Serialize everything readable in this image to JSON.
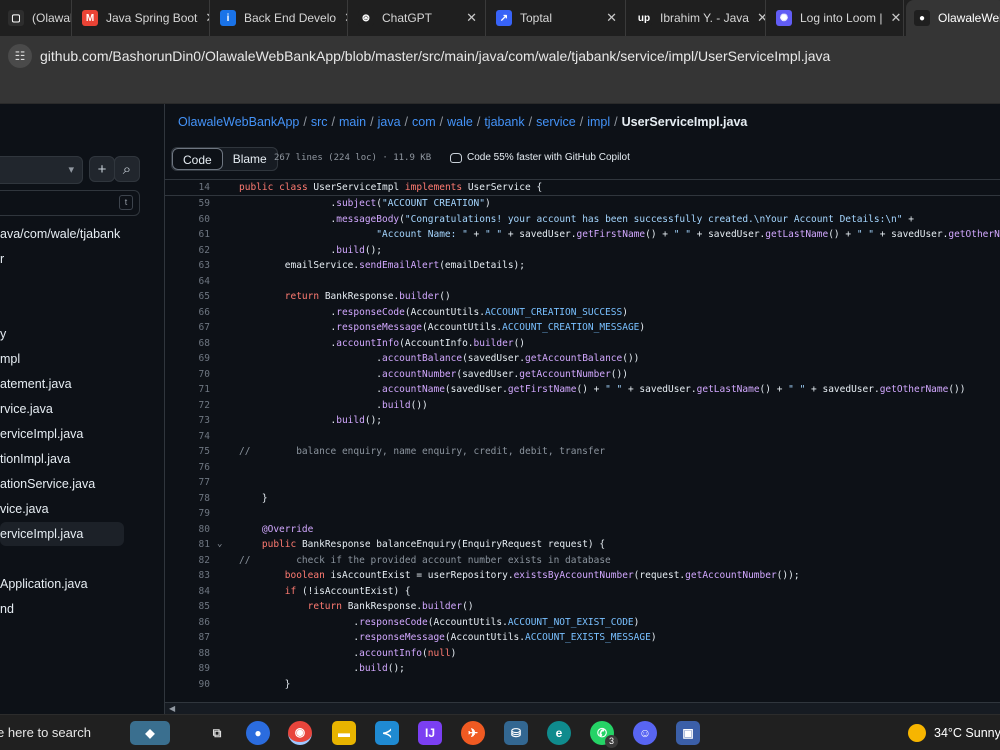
{
  "browser": {
    "tabs": [
      {
        "title": "(Olawale",
        "icon": "generic-page-icon",
        "color": "#2d2d2d"
      },
      {
        "title": "Java Spring Boot",
        "icon": "gmail-icon",
        "color": "#ea4335"
      },
      {
        "title": "Back End Develo",
        "icon": "info-icon",
        "color": "#1a73e8"
      },
      {
        "title": "ChatGPT",
        "icon": "chatgpt-icon",
        "color": "#1f1f1f"
      },
      {
        "title": "Toptal",
        "icon": "toptal-icon",
        "color": "#3863f7"
      },
      {
        "title": "Ibrahim Y. - Java",
        "icon": "upwork-icon",
        "color": "#1f1f1f"
      },
      {
        "title": "Log into Loom |",
        "icon": "loom-icon",
        "color": "#625df5"
      },
      {
        "title": "OlawaleWebBan",
        "icon": "github-icon",
        "color": "#1f1f1f"
      }
    ],
    "url": "github.com/BashorunDin0/OlawaleWebBankApp/blob/master/src/main/java/com/wale/tjabank/service/impl/UserServiceImpl.java"
  },
  "sidebar": {
    "filter_shortcut": "t",
    "items": [
      {
        "label": "ava/com/wale/tjabank"
      },
      {
        "label": "r"
      },
      {
        "label": "y"
      },
      {
        "label": "mpl"
      },
      {
        "label": "atement.java"
      },
      {
        "label": "rvice.java"
      },
      {
        "label": "erviceImpl.java"
      },
      {
        "label": "tionImpl.java"
      },
      {
        "label": "ationService.java"
      },
      {
        "label": "vice.java"
      },
      {
        "label": "erviceImpl.java"
      },
      {
        "label": "Application.java"
      },
      {
        "label": "nd"
      }
    ]
  },
  "breadcrumb": {
    "crumbs": [
      "OlawaleWebBankApp",
      "src",
      "main",
      "java",
      "com",
      "wale",
      "tjabank",
      "service",
      "impl"
    ],
    "current": "UserServiceImpl.java"
  },
  "file_header": {
    "code_tab": "Code",
    "blame_tab": "Blame",
    "meta": "267 lines (224 loc) · 11.9 KB",
    "copilot": "Code 55% faster with GitHub Copilot"
  },
  "code": {
    "sticky": {
      "num": "14",
      "text": "public class UserServiceImpl implements UserService {"
    },
    "lines": [
      {
        "num": "59",
        "text": "                .subject(\"ACCOUNT CREATION\")"
      },
      {
        "num": "60",
        "text": "                .messageBody(\"Congratulations! your account has been successfully created.\\nYour Account Details:\\n\" +"
      },
      {
        "num": "61",
        "text": "                        \"Account Name: \" + \" \" + savedUser.getFirstName() + \" \" + savedUser.getLastName() + \" \" + savedUser.getOtherName() + \"\\nAcco"
      },
      {
        "num": "62",
        "text": "                .build();"
      },
      {
        "num": "63",
        "text": "        emailService.sendEmailAlert(emailDetails);"
      },
      {
        "num": "64",
        "text": ""
      },
      {
        "num": "65",
        "text": "        return BankResponse.builder()"
      },
      {
        "num": "66",
        "text": "                .responseCode(AccountUtils.ACCOUNT_CREATION_SUCCESS)"
      },
      {
        "num": "67",
        "text": "                .responseMessage(AccountUtils.ACCOUNT_CREATION_MESSAGE)"
      },
      {
        "num": "68",
        "text": "                .accountInfo(AccountInfo.builder()"
      },
      {
        "num": "69",
        "text": "                        .accountBalance(savedUser.getAccountBalance())"
      },
      {
        "num": "70",
        "text": "                        .accountNumber(savedUser.getAccountNumber())"
      },
      {
        "num": "71",
        "text": "                        .accountName(savedUser.getFirstName() + \" \" + savedUser.getLastName() + \" \" + savedUser.getOtherName())"
      },
      {
        "num": "72",
        "text": "                        .build())"
      },
      {
        "num": "73",
        "text": "                .build();"
      },
      {
        "num": "74",
        "text": ""
      },
      {
        "num": "75",
        "text": "//        balance enquiry, name enquiry, credit, debit, transfer"
      },
      {
        "num": "76",
        "text": ""
      },
      {
        "num": "77",
        "text": ""
      },
      {
        "num": "78",
        "text": "    }"
      },
      {
        "num": "79",
        "text": ""
      },
      {
        "num": "80",
        "text": "    @Override"
      },
      {
        "num": "81",
        "text": "    public BankResponse balanceEnquiry(EnquiryRequest request) {",
        "fold": true
      },
      {
        "num": "82",
        "text": "//        check if the provided account number exists in database"
      },
      {
        "num": "83",
        "text": "        boolean isAccountExist = userRepository.existsByAccountNumber(request.getAccountNumber());"
      },
      {
        "num": "84",
        "text": "        if (!isAccountExist) {"
      },
      {
        "num": "85",
        "text": "            return BankResponse.builder()"
      },
      {
        "num": "86",
        "text": "                    .responseCode(AccountUtils.ACCOUNT_NOT_EXIST_CODE)"
      },
      {
        "num": "87",
        "text": "                    .responseMessage(AccountUtils.ACCOUNT_EXISTS_MESSAGE)"
      },
      {
        "num": "88",
        "text": "                    .accountInfo(null)"
      },
      {
        "num": "89",
        "text": "                    .build();"
      },
      {
        "num": "90",
        "text": "        }"
      }
    ]
  },
  "taskbar": {
    "search_text": "e here to search",
    "whatsapp_badge": "3",
    "weather": "34°C  Sunny"
  }
}
